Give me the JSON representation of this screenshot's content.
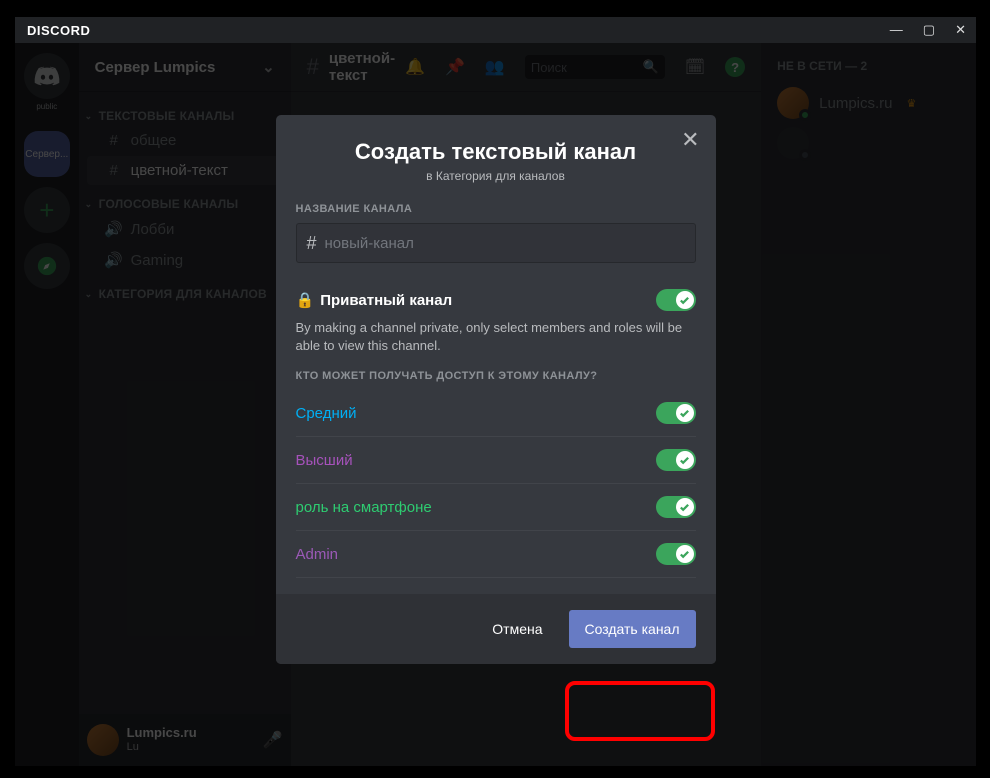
{
  "titlebar": {
    "brand": "DISCORD"
  },
  "guilds": {
    "public_label": "public",
    "selected_label": "Сервер..."
  },
  "server": {
    "name": "Сервер Lumpics"
  },
  "categories": {
    "text": {
      "label": "ТЕКСТОВЫЕ КАНАЛЫ",
      "ch1": "общее",
      "ch2": "цветной-текст"
    },
    "voice": {
      "label": "ГОЛОСОВЫЕ КАНАЛЫ",
      "ch1": "Лобби",
      "ch2": "Gaming"
    },
    "custom": {
      "label": "КАТЕГОРИЯ ДЛЯ КАНАЛОВ"
    }
  },
  "userarea": {
    "name": "Lumpics.ru",
    "sub": "Lu"
  },
  "header": {
    "channel": "цветной-текст",
    "search_placeholder": "Поиск"
  },
  "members": {
    "offline_header": "НЕ В СЕТИ — 2",
    "m1": "Lumpics.ru",
    "m2": ""
  },
  "modal": {
    "title": "Создать текстовый канал",
    "subtitle": "в Категория для каналов",
    "name_label": "НАЗВАНИЕ КАНАЛА",
    "name_placeholder": "новый-канал",
    "private_title": "Приватный канал",
    "private_desc": "By making a channel private, only select members and roles will be able to view this channel.",
    "access_label": "КТО МОЖЕТ ПОЛУЧАТЬ ДОСТУП К ЭТОМУ КАНАЛУ?",
    "role1": "Средний",
    "role2": "Высший",
    "role3": "роль на смартфоне",
    "role4": "Admin",
    "cancel": "Отмена",
    "create": "Создать канал"
  }
}
